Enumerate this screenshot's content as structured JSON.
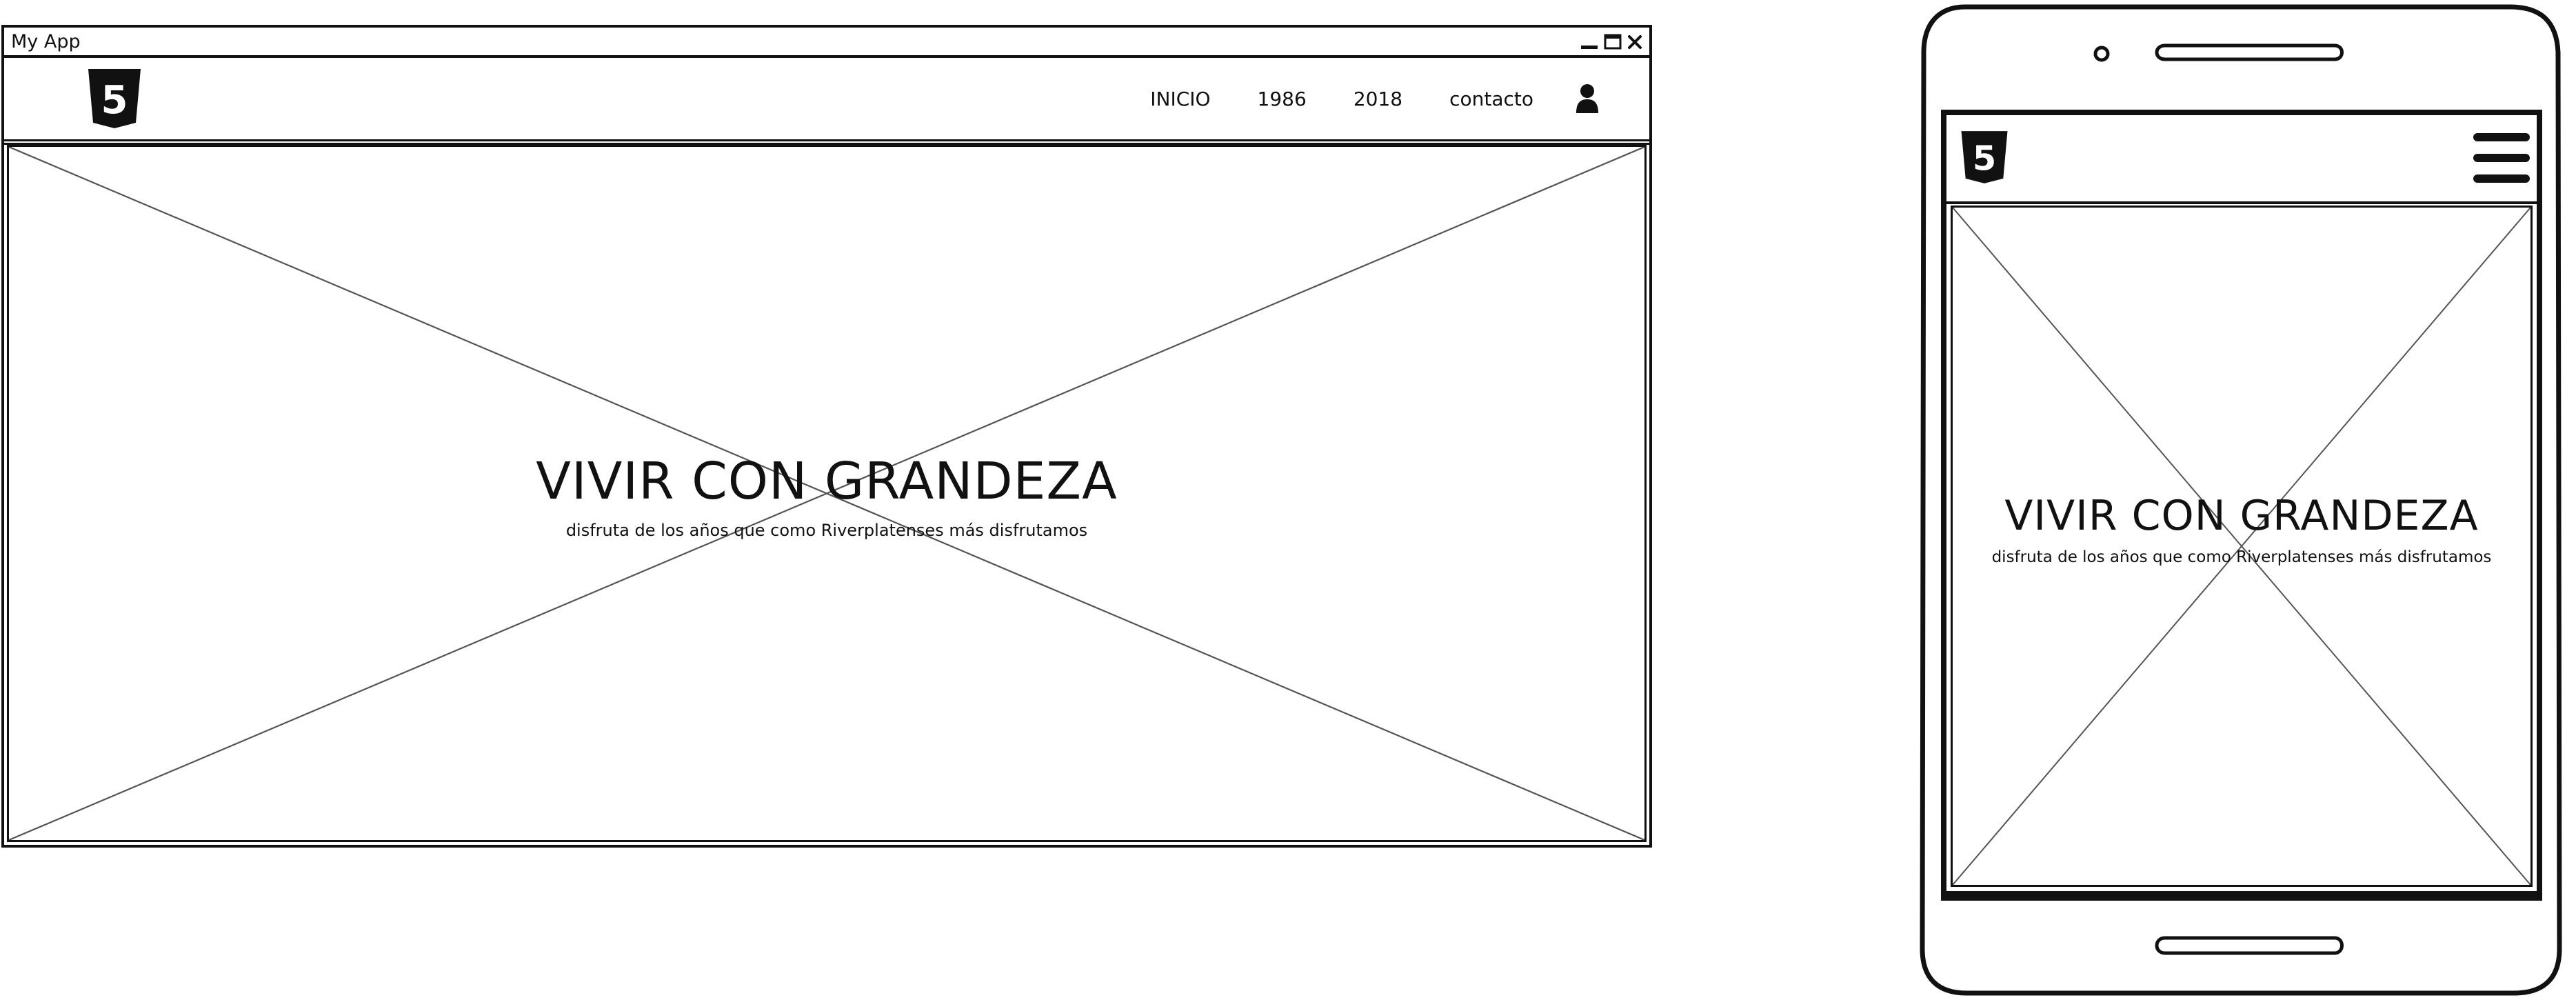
{
  "desktop": {
    "window_title": "My App",
    "window_controls": [
      "minimize-icon",
      "maximize-icon",
      "close-icon"
    ],
    "logo": "html5-logo",
    "logo_text": "5",
    "nav": {
      "items": [
        {
          "label": "INICIO"
        },
        {
          "label": "1986"
        },
        {
          "label": "2018"
        },
        {
          "label": "contacto"
        }
      ],
      "user_icon": "user-icon"
    },
    "hero": {
      "image_placeholder": "image-placeholder",
      "title": "VIVIR CON GRANDEZA",
      "subtitle": "disfruta de los años que como Riverplatenses más disfrutamos"
    }
  },
  "mobile": {
    "logo": "html5-logo",
    "logo_text": "5",
    "menu_icon": "hamburger-menu-icon",
    "hero": {
      "image_placeholder": "image-placeholder",
      "title": "VIVIR CON GRANDEZA",
      "subtitle": "disfruta de los años que como Riverplatenses más disfrutamos"
    }
  },
  "colors": {
    "ink": "#111111",
    "placeholder_line": "#555555",
    "background": "#ffffff"
  }
}
